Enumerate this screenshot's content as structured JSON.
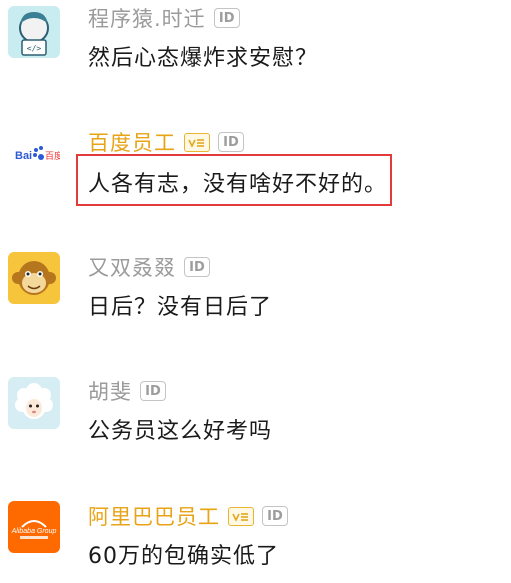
{
  "comments": [
    {
      "name": "程序猿.时迁",
      "id_badge": "ID",
      "text": "然后心态爆炸求安慰？"
    },
    {
      "name": "百度员工",
      "id_badge": "ID",
      "text": "人各有志，没有啥好不好的。",
      "vip": true,
      "avatar_brand": "Bai度"
    },
    {
      "name": "又双叒叕",
      "id_badge": "ID",
      "text": "日后？没有日后了"
    },
    {
      "name": "胡斐",
      "id_badge": "ID",
      "text": "公务员这么好考吗"
    },
    {
      "name": "阿里巴巴员工",
      "id_badge": "ID",
      "text": "60万的包确实低了",
      "vip": true
    }
  ],
  "colors": {
    "name_gray": "#9b9b9b",
    "name_vip": "#e8a317",
    "text": "#1a1a1a",
    "highlight": "#e23b3b"
  },
  "icons": {
    "vip_badge": "verified-employee-badge-icon",
    "id_badge": "id-badge-icon"
  }
}
